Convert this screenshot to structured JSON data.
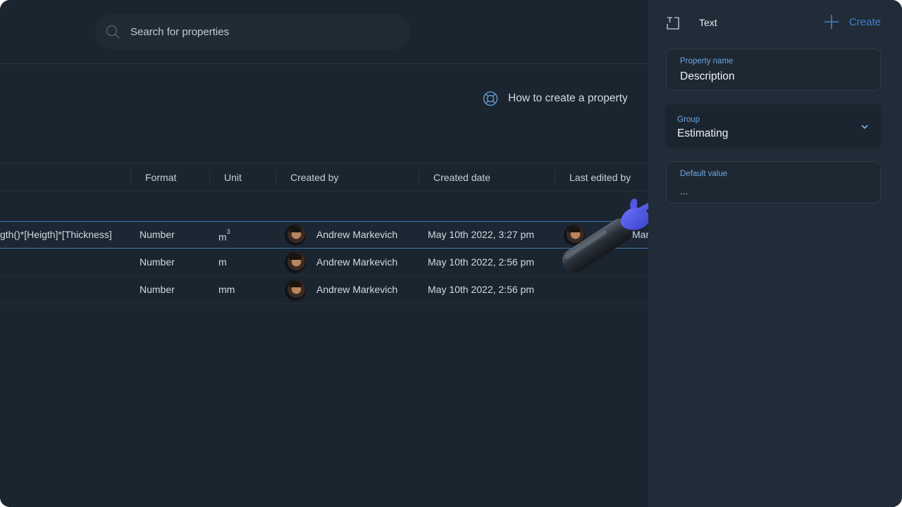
{
  "search": {
    "placeholder": "Search for properties"
  },
  "help": {
    "label": "How to create a property"
  },
  "table": {
    "columns": [
      "Format",
      "Unit",
      "Created by",
      "Created date",
      "Last edited by"
    ],
    "rows": [
      {
        "formula": "gth()*[Heigth]*[Thickness]",
        "format": "Number",
        "unit_base": "m",
        "unit_exp": "3",
        "created_by": "Andrew Markevich",
        "created_date": "May 10th 2022, 3:27 pm",
        "last_edited_by": "Mar"
      },
      {
        "formula": "",
        "format": "Number",
        "unit_base": "m",
        "unit_exp": "",
        "created_by": "Andrew Markevich",
        "created_date": "May 10th 2022, 2:56 pm",
        "last_edited_by": ""
      },
      {
        "formula": "",
        "format": "Number",
        "unit_base": "mm",
        "unit_exp": "",
        "created_by": "Andrew Markevich",
        "created_date": "May 10th 2022, 2:56 pm",
        "last_edited_by": ""
      }
    ]
  },
  "panel": {
    "type_label": "Text",
    "create_label": "Create",
    "property_name": {
      "label": "Property name",
      "value": "Description"
    },
    "group": {
      "label": "Group",
      "value": "Estimating"
    },
    "default_value": {
      "label": "Default value",
      "placeholder": "..."
    }
  },
  "colors": {
    "accent": "#3b82cf",
    "background": "#1b2530",
    "panel": "#212c38",
    "selected_border": "#3a75b0"
  },
  "icons": [
    "search-icon",
    "lifebuoy-icon",
    "text-type-icon",
    "plus-icon",
    "chevron-down-icon",
    "pointer-hand-icon"
  ]
}
